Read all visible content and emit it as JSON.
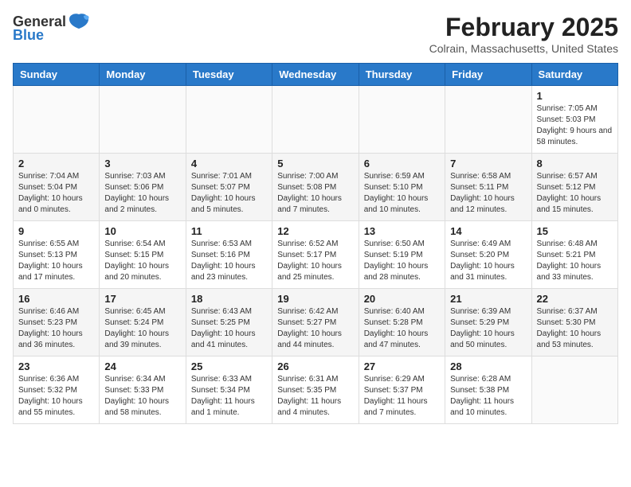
{
  "header": {
    "logo_general": "General",
    "logo_blue": "Blue",
    "month_title": "February 2025",
    "location": "Colrain, Massachusetts, United States"
  },
  "weekdays": [
    "Sunday",
    "Monday",
    "Tuesday",
    "Wednesday",
    "Thursday",
    "Friday",
    "Saturday"
  ],
  "weeks": [
    [
      {
        "day": "",
        "info": ""
      },
      {
        "day": "",
        "info": ""
      },
      {
        "day": "",
        "info": ""
      },
      {
        "day": "",
        "info": ""
      },
      {
        "day": "",
        "info": ""
      },
      {
        "day": "",
        "info": ""
      },
      {
        "day": "1",
        "info": "Sunrise: 7:05 AM\nSunset: 5:03 PM\nDaylight: 9 hours and 58 minutes."
      }
    ],
    [
      {
        "day": "2",
        "info": "Sunrise: 7:04 AM\nSunset: 5:04 PM\nDaylight: 10 hours and 0 minutes."
      },
      {
        "day": "3",
        "info": "Sunrise: 7:03 AM\nSunset: 5:06 PM\nDaylight: 10 hours and 2 minutes."
      },
      {
        "day": "4",
        "info": "Sunrise: 7:01 AM\nSunset: 5:07 PM\nDaylight: 10 hours and 5 minutes."
      },
      {
        "day": "5",
        "info": "Sunrise: 7:00 AM\nSunset: 5:08 PM\nDaylight: 10 hours and 7 minutes."
      },
      {
        "day": "6",
        "info": "Sunrise: 6:59 AM\nSunset: 5:10 PM\nDaylight: 10 hours and 10 minutes."
      },
      {
        "day": "7",
        "info": "Sunrise: 6:58 AM\nSunset: 5:11 PM\nDaylight: 10 hours and 12 minutes."
      },
      {
        "day": "8",
        "info": "Sunrise: 6:57 AM\nSunset: 5:12 PM\nDaylight: 10 hours and 15 minutes."
      }
    ],
    [
      {
        "day": "9",
        "info": "Sunrise: 6:55 AM\nSunset: 5:13 PM\nDaylight: 10 hours and 17 minutes."
      },
      {
        "day": "10",
        "info": "Sunrise: 6:54 AM\nSunset: 5:15 PM\nDaylight: 10 hours and 20 minutes."
      },
      {
        "day": "11",
        "info": "Sunrise: 6:53 AM\nSunset: 5:16 PM\nDaylight: 10 hours and 23 minutes."
      },
      {
        "day": "12",
        "info": "Sunrise: 6:52 AM\nSunset: 5:17 PM\nDaylight: 10 hours and 25 minutes."
      },
      {
        "day": "13",
        "info": "Sunrise: 6:50 AM\nSunset: 5:19 PM\nDaylight: 10 hours and 28 minutes."
      },
      {
        "day": "14",
        "info": "Sunrise: 6:49 AM\nSunset: 5:20 PM\nDaylight: 10 hours and 31 minutes."
      },
      {
        "day": "15",
        "info": "Sunrise: 6:48 AM\nSunset: 5:21 PM\nDaylight: 10 hours and 33 minutes."
      }
    ],
    [
      {
        "day": "16",
        "info": "Sunrise: 6:46 AM\nSunset: 5:23 PM\nDaylight: 10 hours and 36 minutes."
      },
      {
        "day": "17",
        "info": "Sunrise: 6:45 AM\nSunset: 5:24 PM\nDaylight: 10 hours and 39 minutes."
      },
      {
        "day": "18",
        "info": "Sunrise: 6:43 AM\nSunset: 5:25 PM\nDaylight: 10 hours and 41 minutes."
      },
      {
        "day": "19",
        "info": "Sunrise: 6:42 AM\nSunset: 5:27 PM\nDaylight: 10 hours and 44 minutes."
      },
      {
        "day": "20",
        "info": "Sunrise: 6:40 AM\nSunset: 5:28 PM\nDaylight: 10 hours and 47 minutes."
      },
      {
        "day": "21",
        "info": "Sunrise: 6:39 AM\nSunset: 5:29 PM\nDaylight: 10 hours and 50 minutes."
      },
      {
        "day": "22",
        "info": "Sunrise: 6:37 AM\nSunset: 5:30 PM\nDaylight: 10 hours and 53 minutes."
      }
    ],
    [
      {
        "day": "23",
        "info": "Sunrise: 6:36 AM\nSunset: 5:32 PM\nDaylight: 10 hours and 55 minutes."
      },
      {
        "day": "24",
        "info": "Sunrise: 6:34 AM\nSunset: 5:33 PM\nDaylight: 10 hours and 58 minutes."
      },
      {
        "day": "25",
        "info": "Sunrise: 6:33 AM\nSunset: 5:34 PM\nDaylight: 11 hours and 1 minute."
      },
      {
        "day": "26",
        "info": "Sunrise: 6:31 AM\nSunset: 5:35 PM\nDaylight: 11 hours and 4 minutes."
      },
      {
        "day": "27",
        "info": "Sunrise: 6:29 AM\nSunset: 5:37 PM\nDaylight: 11 hours and 7 minutes."
      },
      {
        "day": "28",
        "info": "Sunrise: 6:28 AM\nSunset: 5:38 PM\nDaylight: 11 hours and 10 minutes."
      },
      {
        "day": "",
        "info": ""
      }
    ]
  ]
}
